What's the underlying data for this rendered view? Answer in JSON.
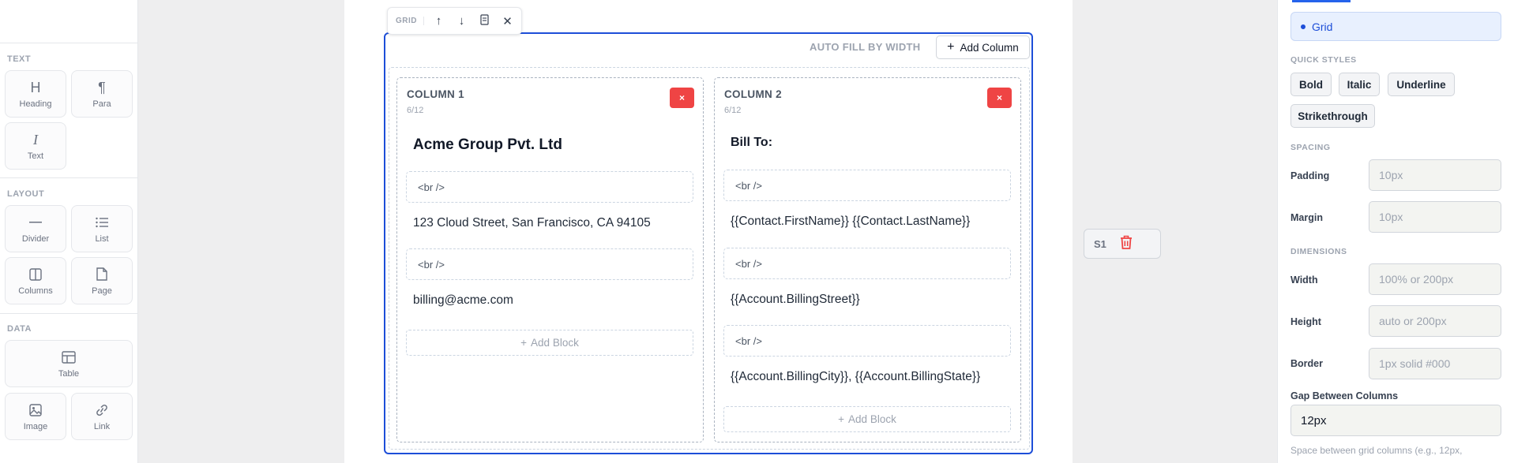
{
  "palette": {
    "sections": {
      "text": "TEXT",
      "layout": "LAYOUT",
      "data": "DATA"
    },
    "items": {
      "heading": {
        "label": "Heading",
        "icon": "heading-icon"
      },
      "para": {
        "label": "Para",
        "icon": "paragraph-icon"
      },
      "text": {
        "label": "Text",
        "icon": "italic-text-icon"
      },
      "divider": {
        "label": "Divider",
        "icon": "divider-icon"
      },
      "list": {
        "label": "List",
        "icon": "list-icon"
      },
      "columns": {
        "label": "Columns",
        "icon": "columns-icon"
      },
      "page": {
        "label": "Page",
        "icon": "page-icon"
      },
      "table": {
        "label": "Table",
        "icon": "table-icon"
      },
      "image": {
        "label": "Image",
        "icon": "image-icon"
      },
      "link": {
        "label": "Link",
        "icon": "link-icon"
      }
    }
  },
  "grid_toolbar": {
    "label": "GRID",
    "buttons": [
      "move-up-icon",
      "move-down-icon",
      "duplicate-icon",
      "close-icon"
    ]
  },
  "grid": {
    "autofill_label": "AUTO FILL BY WIDTH",
    "add_column_label": "Add Column",
    "columns": [
      {
        "title": "COLUMN 1",
        "span": "6/12",
        "delete_label": "×",
        "blocks": {
          "heading": "Acme Group Pvt. Ltd",
          "br1": "<br />",
          "address": "123 Cloud Street, San Francisco, CA 94105",
          "br2": "<br />",
          "email": "billing@acme.com"
        },
        "add_block_label": "Add Block"
      },
      {
        "title": "COLUMN 2",
        "span": "6/12",
        "delete_label": "×",
        "blocks": {
          "bill_to": "Bill To:",
          "br1": "<br />",
          "contact": "{{Contact.FirstName}} {{Contact.LastName}}",
          "br2": "<br />",
          "street": "{{Account.BillingStreet}}",
          "br3": "<br />",
          "city_state": "{{Account.BillingCity}}, {{Account.BillingState}}"
        },
        "add_block_label": "Add Block"
      }
    ]
  },
  "section_chip": {
    "label": "S1",
    "icon": "trash-icon",
    "color": "#ef4444"
  },
  "properties": {
    "selected_type": "Grid",
    "quick_styles_title": "QUICK STYLES",
    "quick_styles": [
      "Bold",
      "Italic",
      "Underline",
      "Strikethrough"
    ],
    "spacing_title": "SPACING",
    "padding_label": "Padding",
    "padding_placeholder": "10px",
    "margin_label": "Margin",
    "margin_placeholder": "10px",
    "dimensions_title": "DIMENSIONS",
    "width_label": "Width",
    "width_placeholder": "100% or 200px",
    "height_label": "Height",
    "height_placeholder": "auto or 200px",
    "border_label": "Border",
    "border_placeholder": "1px solid #000",
    "gap_label": "Gap Between Columns",
    "gap_value": "12px",
    "gap_help": "Space between grid columns (e.g., 12px,"
  },
  "colors": {
    "accent": "#1d4ed8",
    "danger": "#ef4444"
  }
}
